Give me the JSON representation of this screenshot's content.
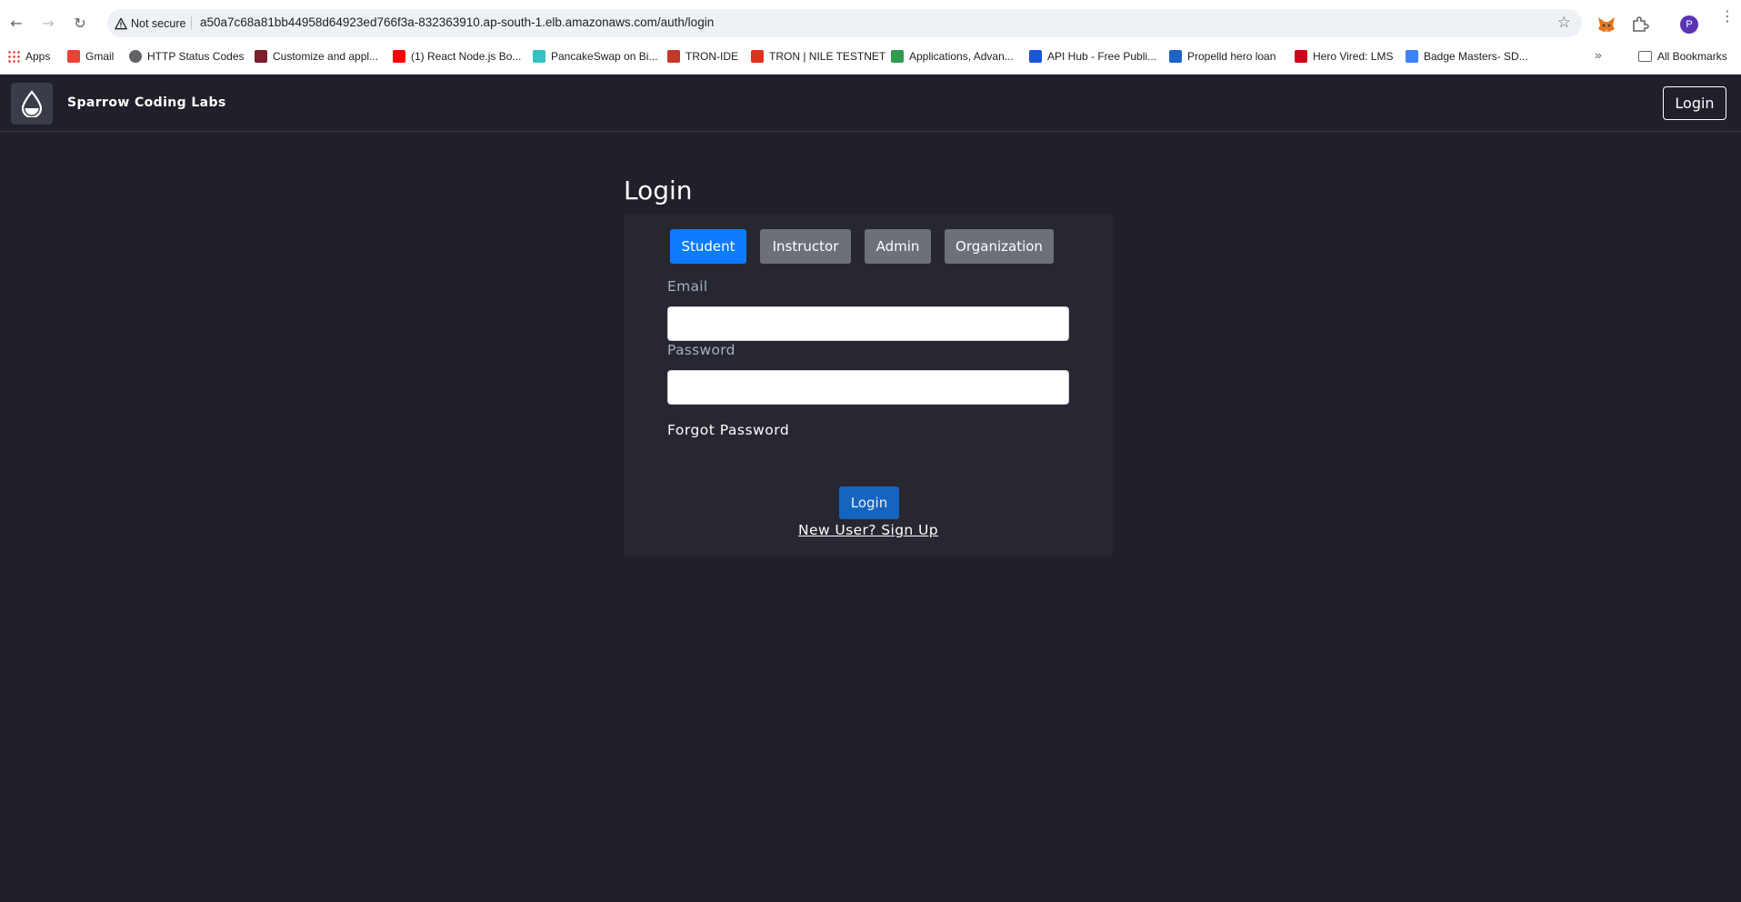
{
  "browser": {
    "security_label": "Not secure",
    "url": "a50a7c68a81bb44958d64923ed766f3a-832363910.ap-south-1.elb.amazonaws.com/auth/login",
    "profile_initial": "P",
    "bookmarks": [
      {
        "label": "Apps",
        "icon": "apps-grid-icon",
        "color": "#ea4335"
      },
      {
        "label": "Gmail",
        "icon": "gmail-icon",
        "color": "#ea4335"
      },
      {
        "label": "HTTP Status Codes",
        "icon": "globe-icon",
        "color": "#5f6368"
      },
      {
        "label": "Customize and appl...",
        "icon": "crown-icon",
        "color": "#7b1f2e"
      },
      {
        "label": "(1) React Node.js Bo...",
        "icon": "youtube-icon",
        "color": "#ff0000"
      },
      {
        "label": "PancakeSwap on Bi...",
        "icon": "pancakeswap-icon",
        "color": "#33c3c3"
      },
      {
        "label": "TRON-IDE",
        "icon": "tron-ide-icon",
        "color": "#c0392b"
      },
      {
        "label": "TRON | NILE TESTNET",
        "icon": "tron-icon",
        "color": "#e0301e"
      },
      {
        "label": "Applications, Advan...",
        "icon": "link-icon",
        "color": "#2e9b4f"
      },
      {
        "label": "API Hub - Free Publi...",
        "icon": "api-hub-icon",
        "color": "#1a56db"
      },
      {
        "label": "Propelld hero loan",
        "icon": "propelld-icon",
        "color": "#1e63c5"
      },
      {
        "label": "Hero Vired: LMS",
        "icon": "hero-vired-icon",
        "color": "#d0021b"
      },
      {
        "label": "Badge Masters- SD...",
        "icon": "badge-icon",
        "color": "#3b82f6"
      }
    ],
    "all_bookmarks_label": "All Bookmarks"
  },
  "navbar": {
    "brand": "Sparrow Coding Labs",
    "login_label": "Login"
  },
  "login": {
    "title": "Login",
    "roles": [
      {
        "label": "Student",
        "active": true
      },
      {
        "label": "Instructor",
        "active": false
      },
      {
        "label": "Admin",
        "active": false
      },
      {
        "label": "Organization",
        "active": false
      }
    ],
    "email_label": "Email",
    "email_value": "",
    "password_label": "Password",
    "password_value": "",
    "forgot_label": "Forgot Password",
    "submit_label": "Login",
    "signup_label": "New User? Sign Up"
  },
  "colors": {
    "page_bg": "#1f2029",
    "card_bg": "#262730",
    "active_role": "#0d7bff",
    "inactive_role": "#6b7079",
    "submit": "#1565c0"
  }
}
